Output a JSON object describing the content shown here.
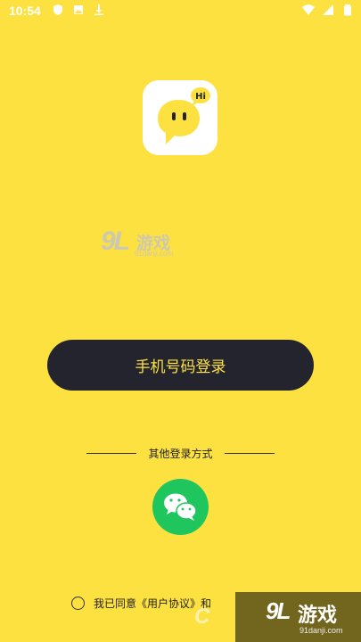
{
  "status_bar": {
    "time": "10:54",
    "left_icons": [
      "shield-icon",
      "image-icon",
      "download-icon"
    ],
    "right_icons": [
      "wifi-icon",
      "signal-icon",
      "battery-icon"
    ]
  },
  "app": {
    "logo_badge_text": "Hi",
    "logo_color": "#fde141"
  },
  "watermark_top": {
    "number": "9L",
    "name": "游戏",
    "url": "91danji.com"
  },
  "login": {
    "phone_button_label": "手机号码登录",
    "other_methods_label": "其他登录方式"
  },
  "agreement": {
    "text": "我已同意《用户协议》和"
  },
  "watermark_bottom": {
    "partial": "C",
    "number": "9L",
    "name": "游戏",
    "url": "91danji.com"
  },
  "colors": {
    "background": "#fde141",
    "button_dark": "#24242f",
    "wechat_green": "#1fc65e"
  }
}
